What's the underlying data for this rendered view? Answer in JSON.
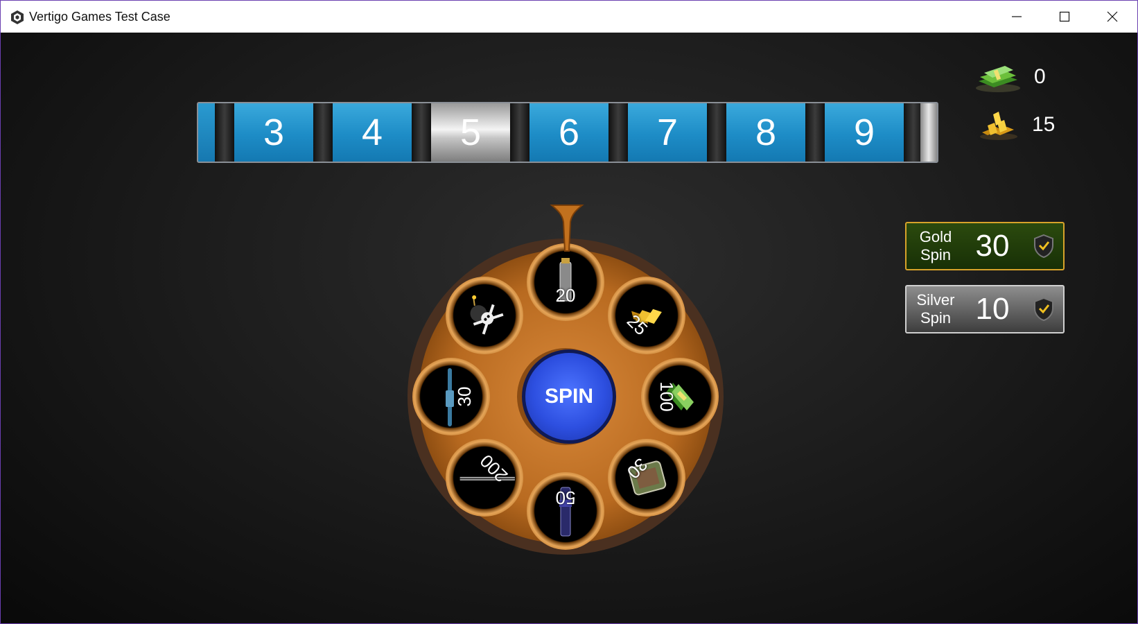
{
  "window": {
    "title": "Vertigo Games Test Case",
    "controls": [
      "minimize-icon",
      "maximize-icon",
      "close-icon"
    ]
  },
  "zones": {
    "items": [
      "3",
      "4",
      "5",
      "6",
      "7",
      "8",
      "9"
    ],
    "active": "5",
    "colors": {
      "normal": "#1d8cc6",
      "active": "#e0e0e0"
    }
  },
  "currency": {
    "cash": {
      "icon": "cash-stack-icon",
      "value": "0"
    },
    "gold": {
      "icon": "gold-bars-icon",
      "value": "15"
    }
  },
  "spin_options": {
    "gold": {
      "label_line1": "Gold",
      "label_line2": "Spin",
      "cost": "30",
      "icon": "shield-check-icon"
    },
    "silver": {
      "label_line1": "Silver",
      "label_line2": "Spin",
      "cost": "10",
      "icon": "shield-check-icon"
    }
  },
  "wheel": {
    "spin_label": "SPIN",
    "slots": [
      {
        "reward": "grenade-icon",
        "value": "20"
      },
      {
        "reward": "gold-bars-icon",
        "value": "25"
      },
      {
        "reward": "cash-stack-icon",
        "value": "100"
      },
      {
        "reward": "armor-vest-icon",
        "value": "30"
      },
      {
        "reward": "flashlight-icon",
        "value": "50"
      },
      {
        "reward": "rifle-icon",
        "value": "200"
      },
      {
        "reward": "sniper-icon",
        "value": "30"
      },
      {
        "reward": "skull-bomb-icon",
        "value": ""
      }
    ],
    "colors": {
      "body": "#c5782a",
      "rim": "#e6a558",
      "spin": "#2d4fe0"
    }
  }
}
